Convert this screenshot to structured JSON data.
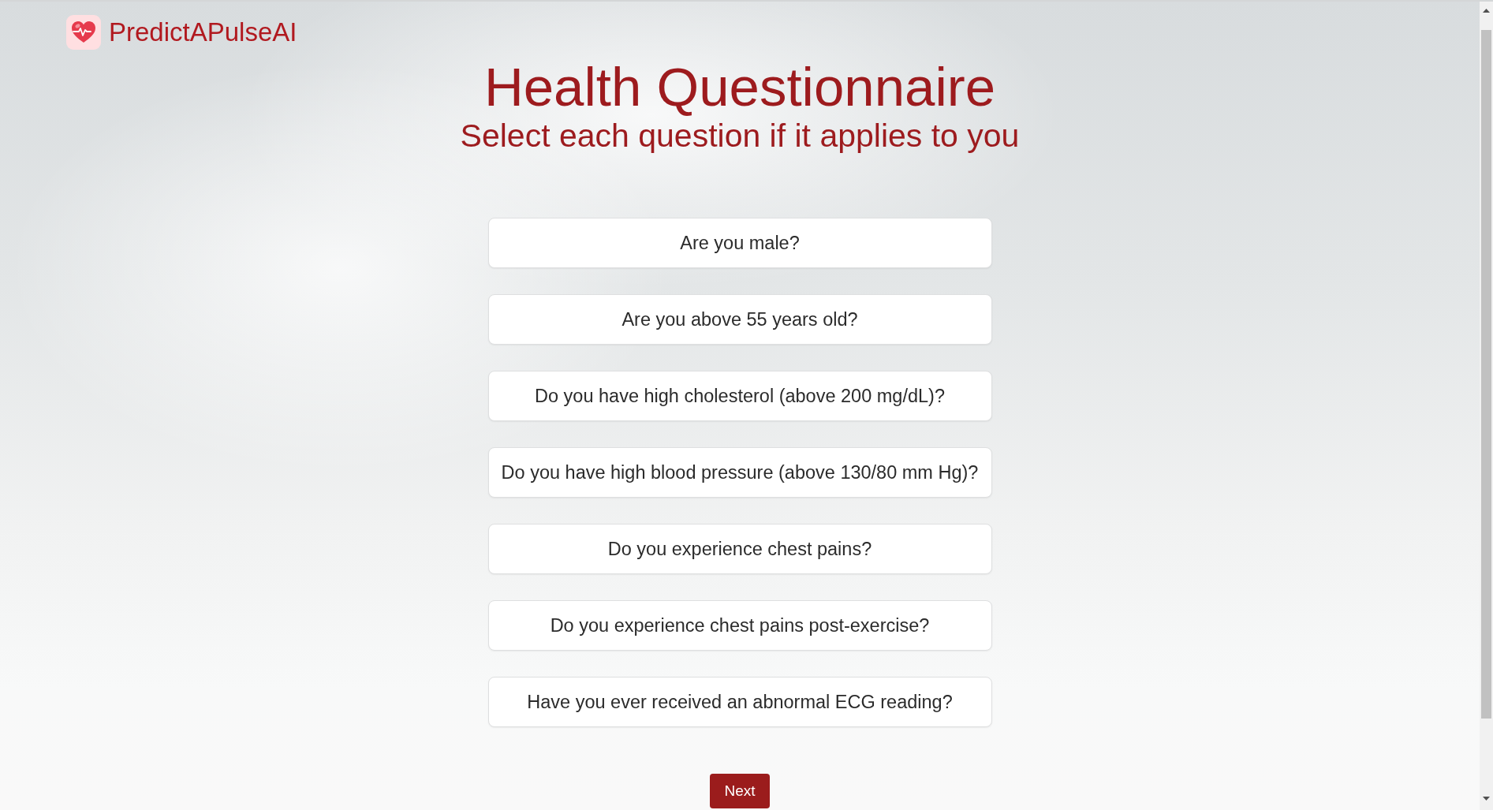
{
  "header": {
    "brand": "PredictAPulseAI"
  },
  "heading": {
    "title": "Health Questionnaire",
    "subtitle": "Select each question if it applies to you"
  },
  "questions": [
    {
      "label": "Are you male?",
      "selected": false
    },
    {
      "label": "Are you above 55 years old?",
      "selected": false
    },
    {
      "label": "Do you have high cholesterol (above 200 mg/dL)?",
      "selected": false
    },
    {
      "label": "Do you have high blood pressure (above 130/80 mm Hg)?",
      "selected": false
    },
    {
      "label": "Do you experience chest pains?",
      "selected": false
    },
    {
      "label": "Do you experience chest pains post-exercise?",
      "selected": false
    },
    {
      "label": "Have you ever received an abnormal ECG reading?",
      "selected": false
    }
  ],
  "next_button": {
    "label": "Next"
  }
}
